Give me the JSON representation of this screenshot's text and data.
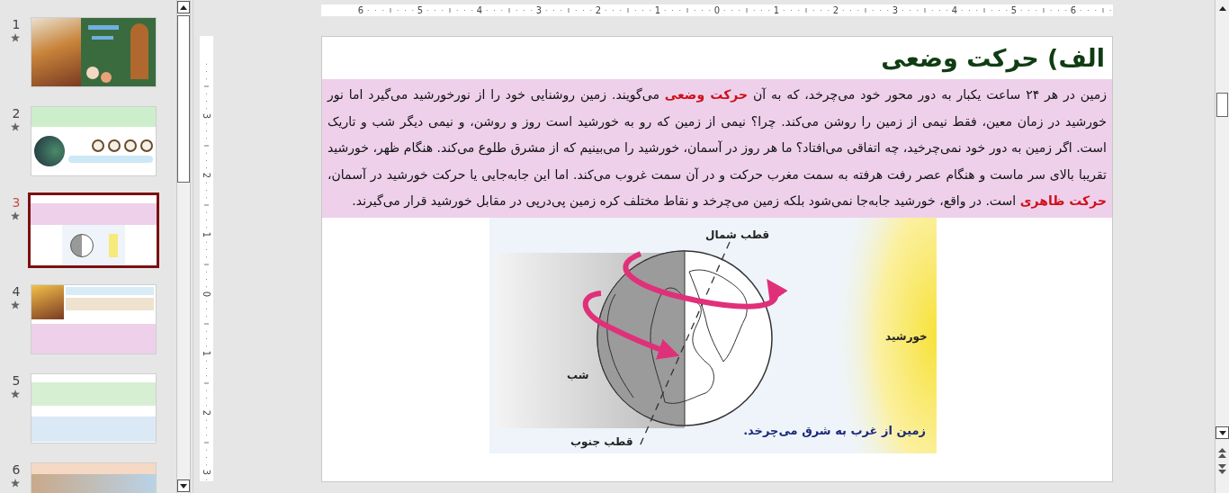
{
  "thumbnails_panel": {
    "slides": [
      {
        "number": "1",
        "kind": "cover",
        "selected": false
      },
      {
        "number": "2",
        "kind": "clocks",
        "selected": false
      },
      {
        "number": "3",
        "kind": "diagram",
        "selected": true
      },
      {
        "number": "4",
        "kind": "image-text",
        "selected": false
      },
      {
        "number": "5",
        "kind": "text",
        "selected": false
      },
      {
        "number": "6",
        "kind": "map",
        "selected": false
      }
    ]
  },
  "rulers": {
    "horizontal": [
      "6",
      "5",
      "4",
      "3",
      "2",
      "1",
      "0",
      "1",
      "2",
      "3",
      "4",
      "5",
      "6"
    ],
    "vertical": [
      "3",
      "2",
      "1",
      "0",
      "1",
      "2",
      "3"
    ]
  },
  "slide": {
    "title": "الف) حرکت وضعی",
    "paragraph": [
      {
        "text": "زمین در هر ۲۴ ساعت یکبار به دور محور خود می‌چرخد، که به آن ",
        "emphasis": false
      },
      {
        "text": "حرکت وضعی",
        "emphasis": true
      },
      {
        "text": " می‌گویند. زمین روشنایی خود را از نورخورشید می‌گیرد اما نور خورشید در زمان معین، فقط نیمی از زمین را روشن می‌کند. چرا؟ نیمی از زمین که رو به خورشید است روز و روشن، و نیمی دیگر شب و تاریک است. اگر زمین به دور خود نمی‌چرخید، چه اتفاقی می‌افتاد؟ ما هر روز در آسمان، خورشید را می‌بینیم که از مشرق طلوع می‌کند. هنگام ظهر، خورشید تقریبا بالای سر ماست و هنگام عصر رفت هرفته به سمت مغرب حرکت و در آن سمت غروب می‌کند. اما این جابه‌جایی یا حرکت خورشید در آسمان، ",
        "emphasis": false
      },
      {
        "text": "حرکت ظاهری",
        "emphasis": true
      },
      {
        "text": " است. در واقع، خورشید جابه‌جا نمی‌شود بلکه زمین می‌چرخد و نقاط مختلف کره زمین پی‌درپی در مقابل خورشید قرار می‌گیرند.",
        "emphasis": false
      }
    ],
    "figure": {
      "north_pole": "قطب شمال",
      "night": "شب",
      "sun": "خورشید",
      "south_pole": "قطب جنوب",
      "caption": "زمین از غرب به شرق می‌چرخد."
    }
  }
}
